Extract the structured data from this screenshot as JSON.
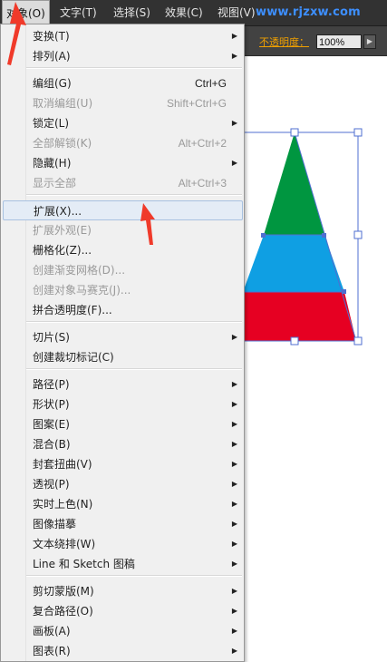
{
  "menubar": {
    "items": [
      "对象(O)",
      "文字(T)",
      "选择(S)",
      "效果(C)",
      "视图(V)"
    ],
    "watermark": "www.rjzxw.com"
  },
  "toolbar": {
    "opacity_label": "不透明度：",
    "opacity_value": "100%"
  },
  "menu": {
    "items": [
      {
        "label": "变换(T)",
        "shortcut": "",
        "submenu": true,
        "disabled": false
      },
      {
        "label": "排列(A)",
        "shortcut": "",
        "submenu": true,
        "disabled": false
      },
      {
        "label": "编组(G)",
        "shortcut": "Ctrl+G",
        "submenu": false,
        "disabled": false
      },
      {
        "label": "取消编组(U)",
        "shortcut": "Shift+Ctrl+G",
        "submenu": false,
        "disabled": true
      },
      {
        "label": "锁定(L)",
        "shortcut": "",
        "submenu": true,
        "disabled": false
      },
      {
        "label": "全部解锁(K)",
        "shortcut": "Alt+Ctrl+2",
        "submenu": false,
        "disabled": true
      },
      {
        "label": "隐藏(H)",
        "shortcut": "",
        "submenu": true,
        "disabled": false
      },
      {
        "label": "显示全部",
        "shortcut": "Alt+Ctrl+3",
        "submenu": false,
        "disabled": true
      },
      {
        "label": "扩展(X)...",
        "shortcut": "",
        "submenu": false,
        "disabled": false,
        "hover": true
      },
      {
        "label": "扩展外观(E)",
        "shortcut": "",
        "submenu": false,
        "disabled": true
      },
      {
        "label": "栅格化(Z)...",
        "shortcut": "",
        "submenu": false,
        "disabled": false
      },
      {
        "label": "创建渐变网格(D)...",
        "shortcut": "",
        "submenu": false,
        "disabled": true
      },
      {
        "label": "创建对象马赛克(J)...",
        "shortcut": "",
        "submenu": false,
        "disabled": true
      },
      {
        "label": "拼合透明度(F)...",
        "shortcut": "",
        "submenu": false,
        "disabled": false
      },
      {
        "label": "切片(S)",
        "shortcut": "",
        "submenu": true,
        "disabled": false
      },
      {
        "label": "创建裁切标记(C)",
        "shortcut": "",
        "submenu": false,
        "disabled": false
      },
      {
        "label": "路径(P)",
        "shortcut": "",
        "submenu": true,
        "disabled": false
      },
      {
        "label": "形状(P)",
        "shortcut": "",
        "submenu": true,
        "disabled": false
      },
      {
        "label": "图案(E)",
        "shortcut": "",
        "submenu": true,
        "disabled": false
      },
      {
        "label": "混合(B)",
        "shortcut": "",
        "submenu": true,
        "disabled": false
      },
      {
        "label": "封套扭曲(V)",
        "shortcut": "",
        "submenu": true,
        "disabled": false
      },
      {
        "label": "透视(P)",
        "shortcut": "",
        "submenu": true,
        "disabled": false
      },
      {
        "label": "实时上色(N)",
        "shortcut": "",
        "submenu": true,
        "disabled": false
      },
      {
        "label": "图像描摹",
        "shortcut": "",
        "submenu": true,
        "disabled": false
      },
      {
        "label": "文本绕排(W)",
        "shortcut": "",
        "submenu": true,
        "disabled": false
      },
      {
        "label": "Line 和 Sketch 图稿",
        "shortcut": "",
        "submenu": true,
        "disabled": false
      },
      {
        "label": "剪切蒙版(M)",
        "shortcut": "",
        "submenu": true,
        "disabled": false
      },
      {
        "label": "复合路径(O)",
        "shortcut": "",
        "submenu": true,
        "disabled": false
      },
      {
        "label": "画板(A)",
        "shortcut": "",
        "submenu": true,
        "disabled": false
      },
      {
        "label": "图表(R)",
        "shortcut": "",
        "submenu": true,
        "disabled": false
      }
    ],
    "submenu_glyph": "▶"
  },
  "colors": {
    "menubar_bg": "#323232",
    "menu_bg": "#f0f0f0",
    "triangle_top": "#009640",
    "triangle_middle": "#0f9fe3",
    "triangle_bottom": "#e60022",
    "selection": "#4f6fd0",
    "annotation_arrow": "#f03a2a"
  }
}
